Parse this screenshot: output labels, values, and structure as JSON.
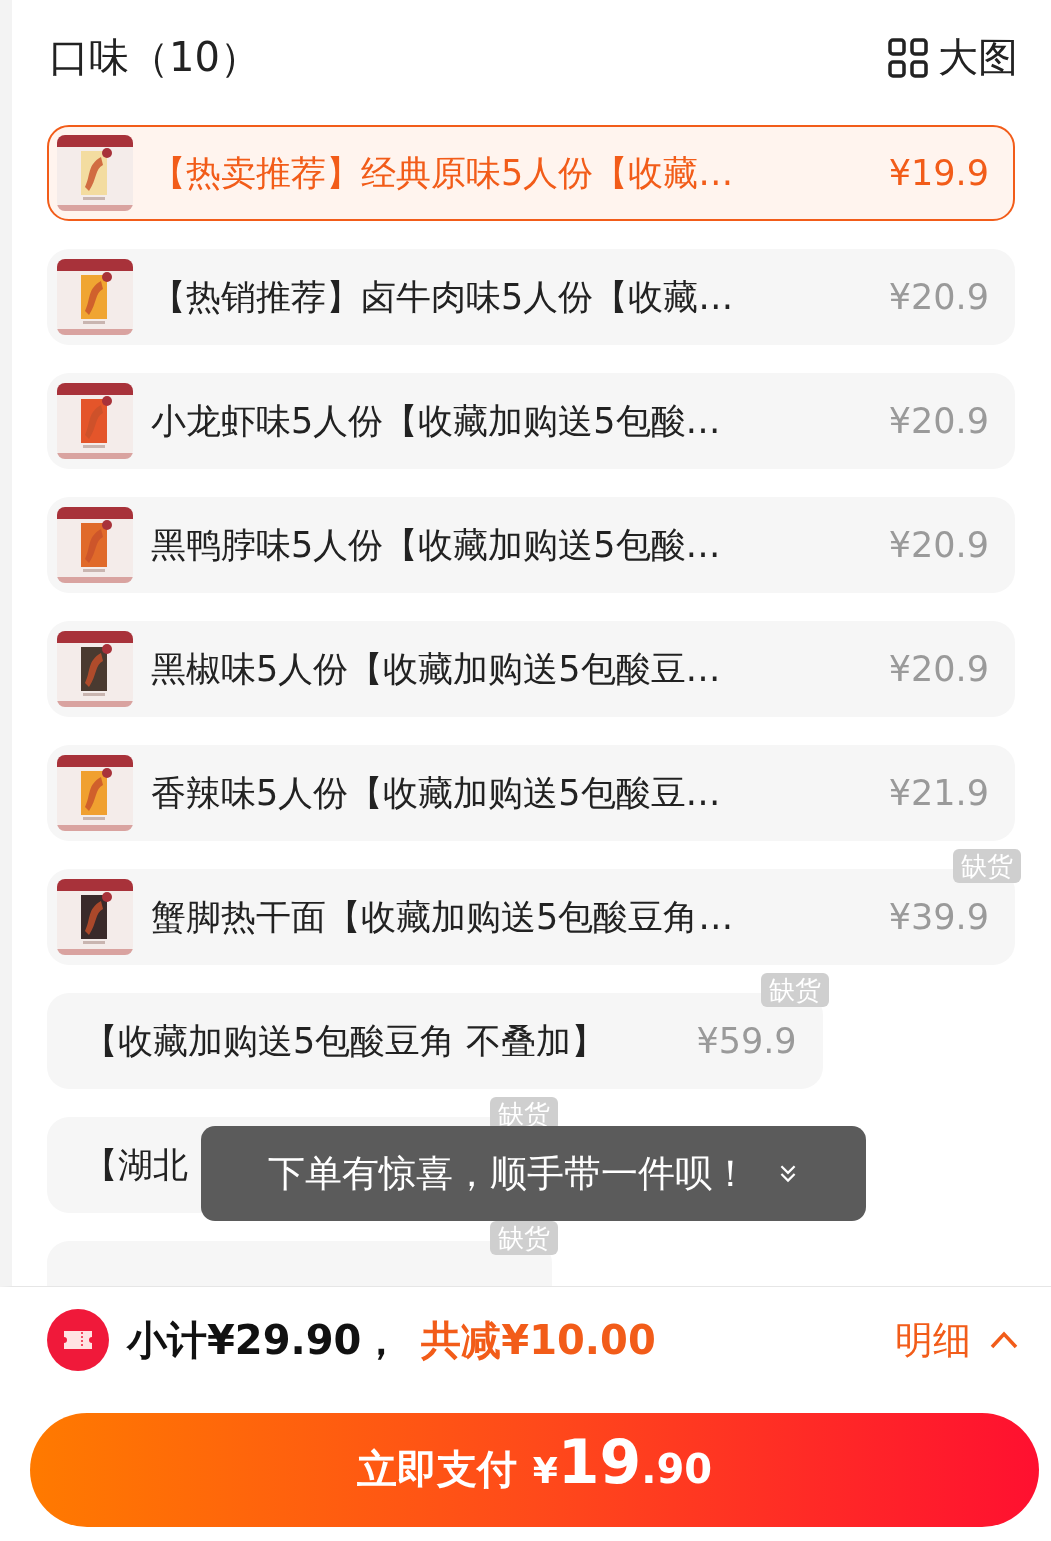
{
  "header": {
    "title": "口味（10）",
    "view_toggle": "大图"
  },
  "items": [
    {
      "name": "【热卖推荐】经典原味5人份【收藏…",
      "price": "¥19.9",
      "selected": true
    },
    {
      "name": "【热销推荐】卤牛肉味5人份【收藏…",
      "price": "¥20.9",
      "selected": false
    },
    {
      "name": "小龙虾味5人份【收藏加购送5包酸…",
      "price": "¥20.9",
      "selected": false
    },
    {
      "name": "黑鸭脖味5人份【收藏加购送5包酸…",
      "price": "¥20.9",
      "selected": false
    },
    {
      "name": "黑椒味5人份【收藏加购送5包酸豆…",
      "price": "¥20.9",
      "selected": false
    },
    {
      "name": "香辣味5人份【收藏加购送5包酸豆…",
      "price": "¥21.9",
      "selected": false
    },
    {
      "name": "蟹脚热干面【收藏加购送5包酸豆角…",
      "price": "¥39.9",
      "selected": false,
      "badge": "缺货"
    },
    {
      "kind": "text",
      "name": "【收藏加购送5包酸豆角 不叠加】",
      "price": "¥59.9",
      "selected": false,
      "badge": "缺货"
    },
    {
      "kind": "text",
      "name": "【湖北",
      "selected": false,
      "badge": "缺货"
    },
    {
      "kind": "text",
      "selected": false,
      "badge": "缺货"
    }
  ],
  "toast": {
    "text": "下单有惊喜，顺手带一件呗！"
  },
  "summary": {
    "subtotal": "小计¥29.90，",
    "discount": "共减¥10.00",
    "details": "明细"
  },
  "pay_button": {
    "label": "立即支付",
    "currency": "¥",
    "integer": "19",
    "decimal": ".90"
  }
}
